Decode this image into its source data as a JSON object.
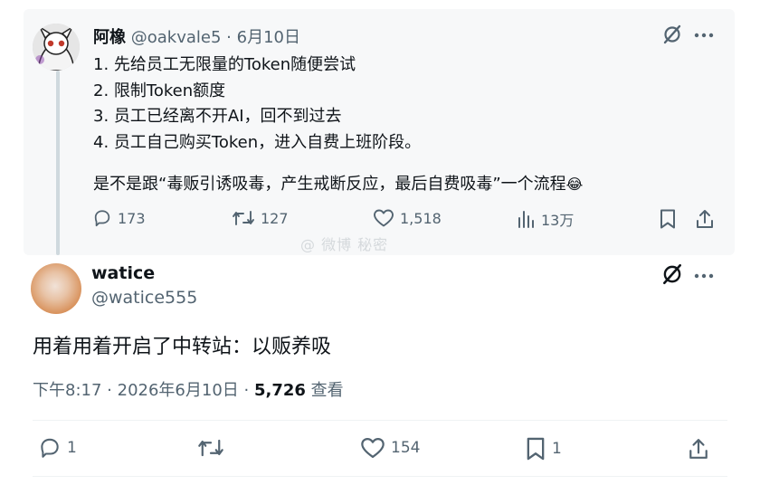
{
  "quoted_post": {
    "author_name": "阿橡",
    "handle": "@oakvale5",
    "separator": "·",
    "date": "6月10日",
    "lines": [
      "1. 先给员工无限量的Token随便尝试",
      "2. 限制Token额度",
      "3. 员工已经离不开AI，回不到过去",
      "4. 员工自己购买Token，进入自费上班阶段。"
    ],
    "closing": "是不是跟“毒贩引诱吸毒，产生戒断反应，最后自费吸毒”一个流程",
    "closing_emoji": "😂",
    "stats": {
      "replies": "173",
      "reposts": "127",
      "likes": "1,518",
      "views": "13万"
    }
  },
  "watermark": "@ 微博 秘密",
  "main_post": {
    "author_name": "watice",
    "handle": "@watice555",
    "text": "用着用着开启了中转站：以贩养吸",
    "time": "下午8:17",
    "separator": "·",
    "date": "2026年6月10日",
    "dot": "·",
    "views": "5,726",
    "views_label": "查看",
    "stats": {
      "replies": "1",
      "reposts": "",
      "likes": "154",
      "bookmarks": "1"
    }
  },
  "icons": {
    "grok": "grok-icon",
    "more": "more-icon",
    "reply": "reply-icon",
    "repost": "repost-icon",
    "like": "heart-icon",
    "views": "views-icon",
    "bookmark": "bookmark-icon",
    "share": "share-icon"
  },
  "colors": {
    "text": "#0f1419",
    "secondary": "#536471",
    "background": "#ffffff"
  }
}
